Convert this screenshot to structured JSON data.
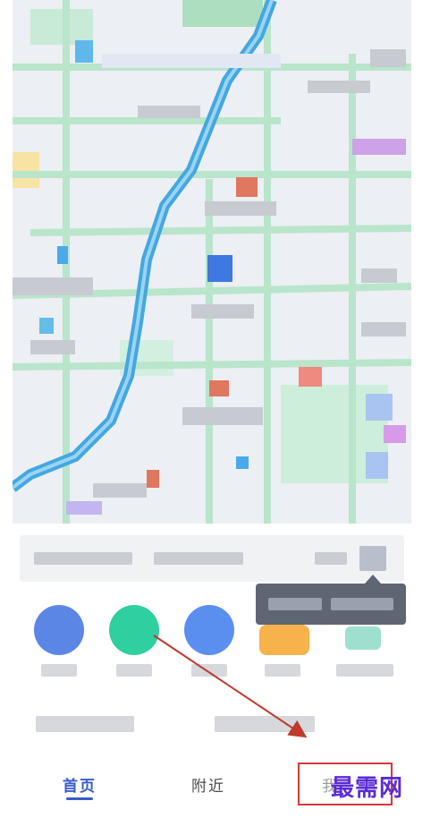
{
  "nav": {
    "home_label": "首页",
    "nearby_label": "附近",
    "me_label": "我"
  },
  "watermark": {
    "text": "最需网"
  },
  "colors": {
    "accent": "#3a5cc9",
    "annotation_red": "#c0392b",
    "watermark_purple": "#5b2bd6"
  },
  "icons": {
    "shortcuts": [
      "bus-icon",
      "ride-icon",
      "subway-icon",
      "food-icon",
      "more-icon"
    ]
  }
}
